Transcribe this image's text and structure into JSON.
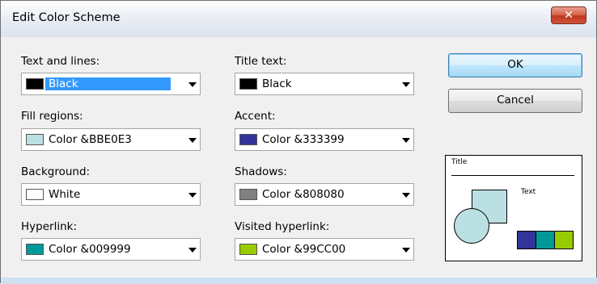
{
  "dialog": {
    "title": "Edit Color Scheme",
    "close_label": "✕"
  },
  "fields": [
    {
      "label": "Text and lines:",
      "value": "Black",
      "swatch": "#000000"
    },
    {
      "label": "Title text:",
      "value": "Black",
      "swatch": "#000000"
    },
    {
      "label": "Fill regions:",
      "value": "Color &BBE0E3",
      "swatch": "#BBE0E3"
    },
    {
      "label": "Accent:",
      "value": "Color &333399",
      "swatch": "#333399"
    },
    {
      "label": "Background:",
      "value": "White",
      "swatch": "#FFFFFF"
    },
    {
      "label": "Shadows:",
      "value": "Color &808080",
      "swatch": "#808080"
    },
    {
      "label": "Hyperlink:",
      "value": "Color &009999",
      "swatch": "#009999"
    },
    {
      "label": "Visited hyperlink:",
      "value": "Color &99CC00",
      "swatch": "#99CC00"
    }
  ],
  "buttons": {
    "ok": "OK",
    "cancel": "Cancel"
  },
  "preview": {
    "title": "Title",
    "text": "Text",
    "shape_fill": "#BBE0E3",
    "bars": [
      "#333399",
      "#009999",
      "#99CC00"
    ]
  }
}
